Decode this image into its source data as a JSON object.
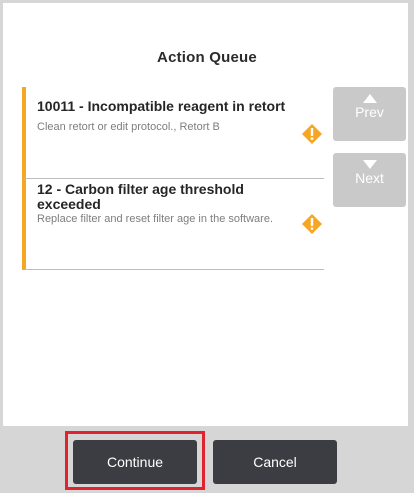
{
  "dialog": {
    "title": "Action Queue"
  },
  "queue": [
    {
      "title": "10011 - Incompatible reagent in retort",
      "description": "Clean retort or edit protocol., Retort B",
      "icon": "warning-icon"
    },
    {
      "title": "12 - Carbon filter age threshold exceeded",
      "description": "Replace filter and reset filter age in the software.",
      "icon": "warning-icon"
    }
  ],
  "nav": {
    "prev_label": "Prev",
    "next_label": "Next",
    "prev_icon": "arrow-up-icon",
    "next_icon": "arrow-down-icon"
  },
  "footer": {
    "continue_label": "Continue",
    "cancel_label": "Cancel"
  },
  "colors": {
    "accent": "#f5a623",
    "button_dark": "#3b3d42",
    "button_disabled": "#c9c9c9",
    "highlight": "#e0232e"
  }
}
